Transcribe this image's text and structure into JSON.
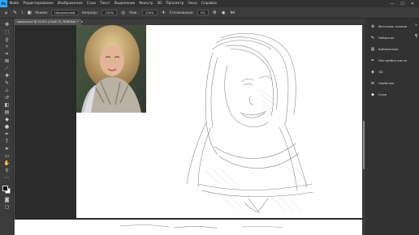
{
  "app": {
    "logo_text": "Ps",
    "brand_color": "#31a8ff"
  },
  "menu": {
    "items": [
      "Файл",
      "Редактирование",
      "Изображение",
      "Слои",
      "Текст",
      "Выделение",
      "Фильтр",
      "3D",
      "Просмотр",
      "Окно",
      "Справка"
    ],
    "window_controls": [
      "—",
      "☐",
      "✕"
    ]
  },
  "options": {
    "mode_label": "Режим:",
    "mode_value": "Нормальный",
    "opacity_label": "Непрозр.:",
    "opacity_value": "100%",
    "flow_label": "Наж.:",
    "flow_value": "100%",
    "smoothing_label": "Сглаживание:",
    "smoothing_value": "0%",
    "brush_size": "1"
  },
  "document": {
    "tab_title": "мамка.psd @ 42,8% (Слой 13, RGB/8#) *",
    "close_glyph": "×"
  },
  "tools": [
    "move-icon",
    "marquee-icon",
    "lasso-icon",
    "quick-select-icon",
    "crop-icon",
    "frame-icon",
    "eyedropper-icon",
    "healing-icon",
    "brush-icon",
    "stamp-icon",
    "history-brush-icon",
    "eraser-icon",
    "gradient-icon",
    "blur-icon",
    "dodge-icon",
    "pen-icon",
    "type-icon",
    "path-select-icon",
    "rectangle-icon",
    "hand-icon",
    "zoom-icon",
    "more-icon"
  ],
  "colors": {
    "foreground": "#000000",
    "background": "#ffffff"
  },
  "panels": {
    "items": [
      {
        "label": "Источник клонов",
        "icon": "clone-source-icon"
      },
      {
        "label": "Набросок",
        "icon": "sketch-icon"
      },
      {
        "label": "Библиотеки",
        "icon": "libraries-icon"
      },
      {
        "label": "Настройки кисти",
        "icon": "brush-settings-icon"
      },
      {
        "label": "3D",
        "icon": "3d-icon"
      },
      {
        "label": "Свойства",
        "icon": "properties-icon"
      },
      {
        "label": "Слои",
        "icon": "layers-icon"
      }
    ]
  }
}
